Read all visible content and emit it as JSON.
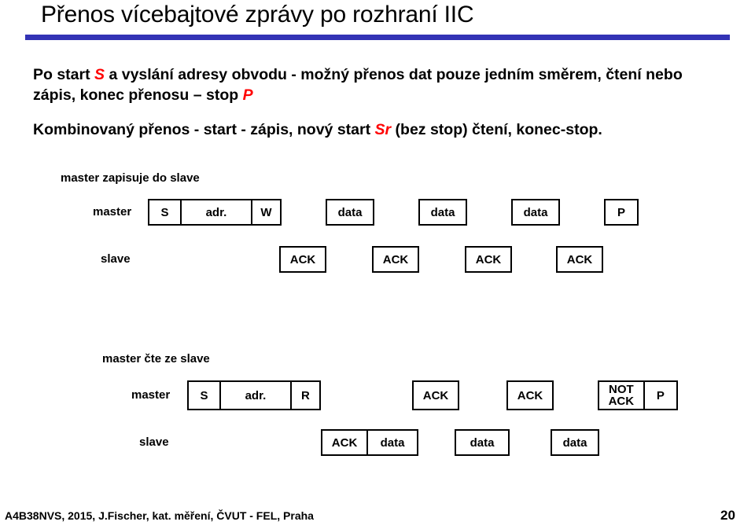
{
  "slide": {
    "title": "Přenos vícebajtové zprávy po rozhraní IIC",
    "rule_color": "#3333b5",
    "accent_color": "#ff0000"
  },
  "body": {
    "para1": {
      "seg1": "Po start ",
      "hl1": "S",
      "seg2": " a vyslání adresy obvodu - možný přenos dat pouze jedním směrem, čtení nebo zápis, konec  přenosu – stop ",
      "hl2": "P"
    },
    "para2": {
      "seg1": "Kombinovaný přenos - start - zápis, nový start ",
      "hl1": "Sr",
      "seg2": " (bez stop) čtení, konec-stop."
    }
  },
  "diagram_write": {
    "caption": "master zapisuje do slave",
    "master_label": "master",
    "slave_label": "slave",
    "master_frames": [
      {
        "cells": [
          "S",
          "adr.",
          "W"
        ]
      },
      {
        "cells": [
          "data"
        ]
      },
      {
        "cells": [
          "data"
        ]
      },
      {
        "cells": [
          "data"
        ]
      },
      {
        "cells": [
          "P"
        ]
      }
    ],
    "slave_frames": [
      {
        "cells": [
          "ACK"
        ]
      },
      {
        "cells": [
          "ACK"
        ]
      },
      {
        "cells": [
          "ACK"
        ]
      },
      {
        "cells": [
          "ACK"
        ]
      }
    ]
  },
  "diagram_read": {
    "caption": "master čte ze slave",
    "master_label": "master",
    "slave_label": "slave",
    "master_frames": [
      {
        "cells": [
          "S",
          "adr.",
          "R"
        ]
      },
      {
        "cells": [
          "ACK"
        ]
      },
      {
        "cells": [
          "ACK"
        ]
      },
      {
        "cells": [
          "NOT\nACK",
          "P"
        ]
      }
    ],
    "slave_frames": [
      {
        "cells": [
          "ACK",
          "data"
        ]
      },
      {
        "cells": [
          "data"
        ]
      },
      {
        "cells": [
          "data"
        ]
      }
    ]
  },
  "footer": {
    "credit": "A4B38NVS, 2015, J.Fischer, kat. měření,  ČVUT - FEL, Praha",
    "page": "20"
  }
}
